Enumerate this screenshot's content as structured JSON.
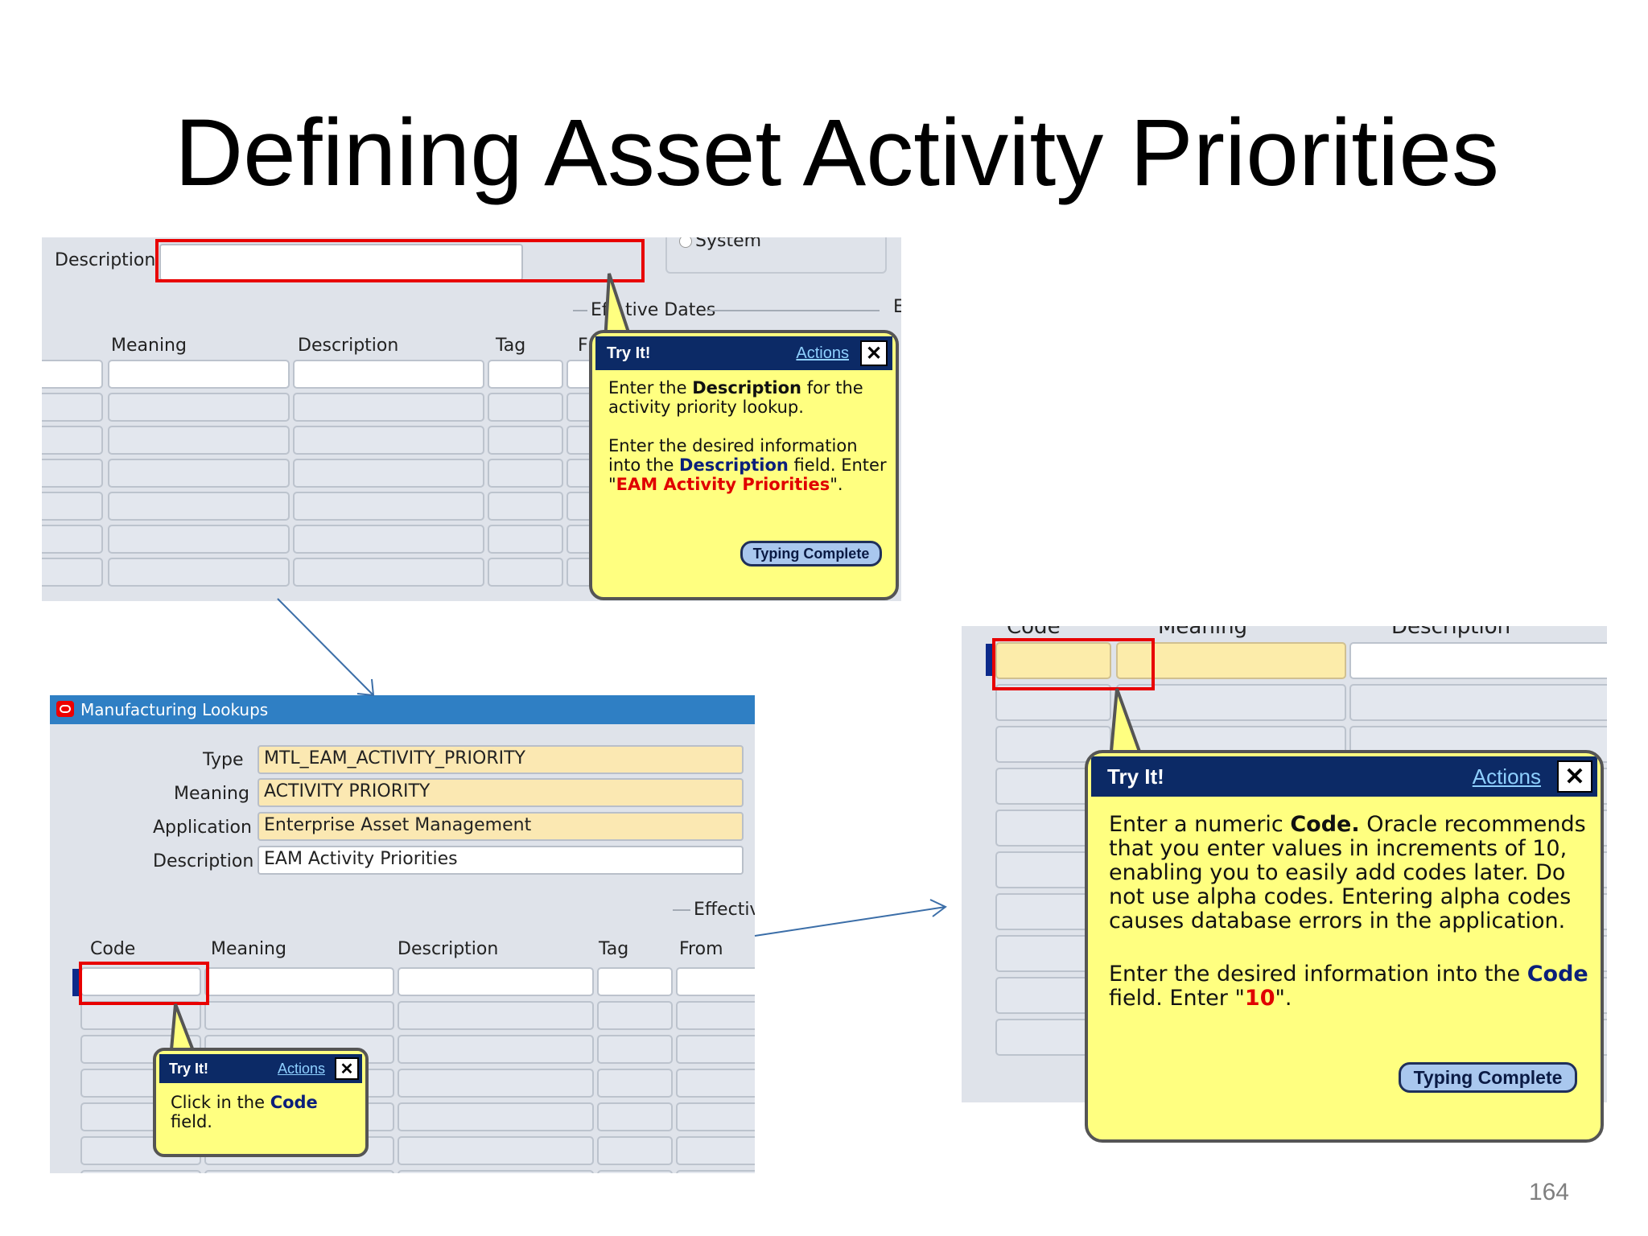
{
  "slide": {
    "title": "Defining Asset Activity Priorities",
    "page_number": "164"
  },
  "screenshot_top": {
    "description_label": "Description",
    "system_radio": "System",
    "effective_dates": "Effective Dates",
    "effective_dates_visible": "Eff",
    "effective_dates_visible_2": "tive Dates",
    "edge_letter": "E",
    "columns": [
      "Meaning",
      "Description",
      "Tag",
      "F"
    ],
    "tooltip": {
      "header": "Try It!",
      "actions": "Actions",
      "close": "✕",
      "p1_a": "Enter the ",
      "p1_b": "Description",
      "p1_c": " for the activity priority lookup.",
      "p2_a": "Enter the desired information into the ",
      "p2_b": "Description",
      "p2_c": " field. Enter \"",
      "p2_d": "EAM Activity Priorities",
      "p2_e": "\".",
      "button": "Typing Complete"
    }
  },
  "screenshot_left": {
    "window_title": "Manufacturing Lookups",
    "form": {
      "type_label": "Type",
      "type_value": "MTL_EAM_ACTIVITY_PRIORITY",
      "meaning_label": "Meaning",
      "meaning_value": "ACTIVITY PRIORITY",
      "application_label": "Application",
      "application_value": "Enterprise Asset Management",
      "description_label": "Description",
      "description_value": "EAM Activity Priorities"
    },
    "effective": "Effective",
    "columns": [
      "Code",
      "Meaning",
      "Description",
      "Tag",
      "From"
    ],
    "tooltip": {
      "header": "Try It!",
      "actions": "Actions",
      "close": "✕",
      "p1_a": "Click in the ",
      "p1_b": "Code",
      "p1_c": " field."
    }
  },
  "screenshot_right": {
    "columns": [
      "Code",
      "Meaning",
      "Description"
    ],
    "tooltip": {
      "header": "Try It!",
      "actions": "Actions",
      "close": "✕",
      "p1_a": "Enter a numeric ",
      "p1_b": "Code.",
      "p1_c": " Oracle recommends that you enter values in increments of 10, enabling you to easily add codes later. Do not use alpha codes. Entering alpha codes causes database errors in the application.",
      "p2_a": "Enter the desired information into the ",
      "p2_b": "Code",
      "p2_c": " field. Enter \"",
      "p2_d": "10",
      "p2_e": "\".",
      "button": "Typing Complete"
    }
  },
  "colors": {
    "tooltip_bg": "#ffff80",
    "tooltip_header": "#0c2a66",
    "highlight": "#e80000",
    "window_title_bar": "#2f7fc4",
    "arrow": "#3b6ea8"
  }
}
